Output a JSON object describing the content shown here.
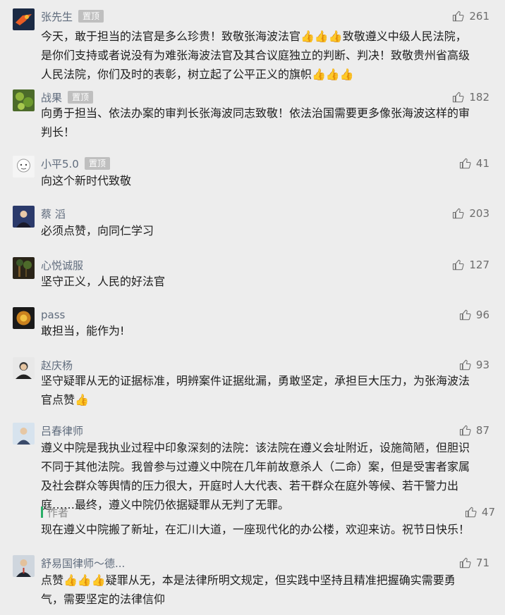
{
  "like_icon": "thumbs-up-outline-icon",
  "badge_color": "#bfbfbf",
  "reply_bar_color": "#2aae67",
  "comments": [
    {
      "name": "张先生",
      "badge": "置顶",
      "likes": "261",
      "text": "今天，敢于担当的法官是多么珍贵！致敬张海波法官👍👍👍致敬遵义中级人民法院，\n是你们支持或者说没有为难张海波法官及其合议庭独立的判断、判决！致敬贵州省高级\n人民法院，你们及时的表彰，树立起了公平正义的旗帜👍👍👍"
    },
    {
      "name": "战果",
      "badge": "置顶",
      "likes": "182",
      "text": "向勇于担当、依法办案的审判长张海波同志致敬！依法治国需要更多像张海波这样的审\n判长！"
    },
    {
      "name": "小平5.0",
      "badge": "置顶",
      "likes": "41",
      "text": "向这个新时代致敬"
    },
    {
      "name": "蔡 滔",
      "badge": "",
      "likes": "203",
      "text": "必须点赞，向同仁学习"
    },
    {
      "name": "心悦诚服",
      "badge": "",
      "likes": "127",
      "text": "坚守正义，人民的好法官"
    },
    {
      "name": "pass",
      "badge": "",
      "likes": "96",
      "text": "敢担当，能作为!"
    },
    {
      "name": "赵庆杨",
      "badge": "",
      "likes": "93",
      "text": "坚守疑罪从无的证据标准，明辨案件证据纰漏，勇敢坚定，承担巨大压力，为张海波法\n官点赞👍"
    },
    {
      "name": "吕春律师",
      "badge": "",
      "likes": "87",
      "text": "遵义中院是我执业过程中印象深刻的法院：该法院在遵义会址附近，设施简陋，但胆识\n不同于其他法院。我曾参与过遵义中院在几年前故意杀人（二命）案，但是受害者家属\n及社会群众等舆情的压力很大，开庭时人大代表、若干群众在庭外等候、若干警力出\n庭……最终，遵义中院仍依据疑罪从无判了无罪。",
      "reply": {
        "label": "作者",
        "likes": "47",
        "text": "现在遵义中院搬了新址，在汇川大道，一座现代化的办公楼，欢迎来访。祝节日快乐！"
      }
    },
    {
      "name": "舒易国律师～德...",
      "badge": "",
      "likes": "71",
      "text": "点赞👍👍👍疑罪从无，本是法律所明文规定，但实践中坚持且精准把握确实需要勇\n气，需要坚定的法律信仰"
    }
  ]
}
